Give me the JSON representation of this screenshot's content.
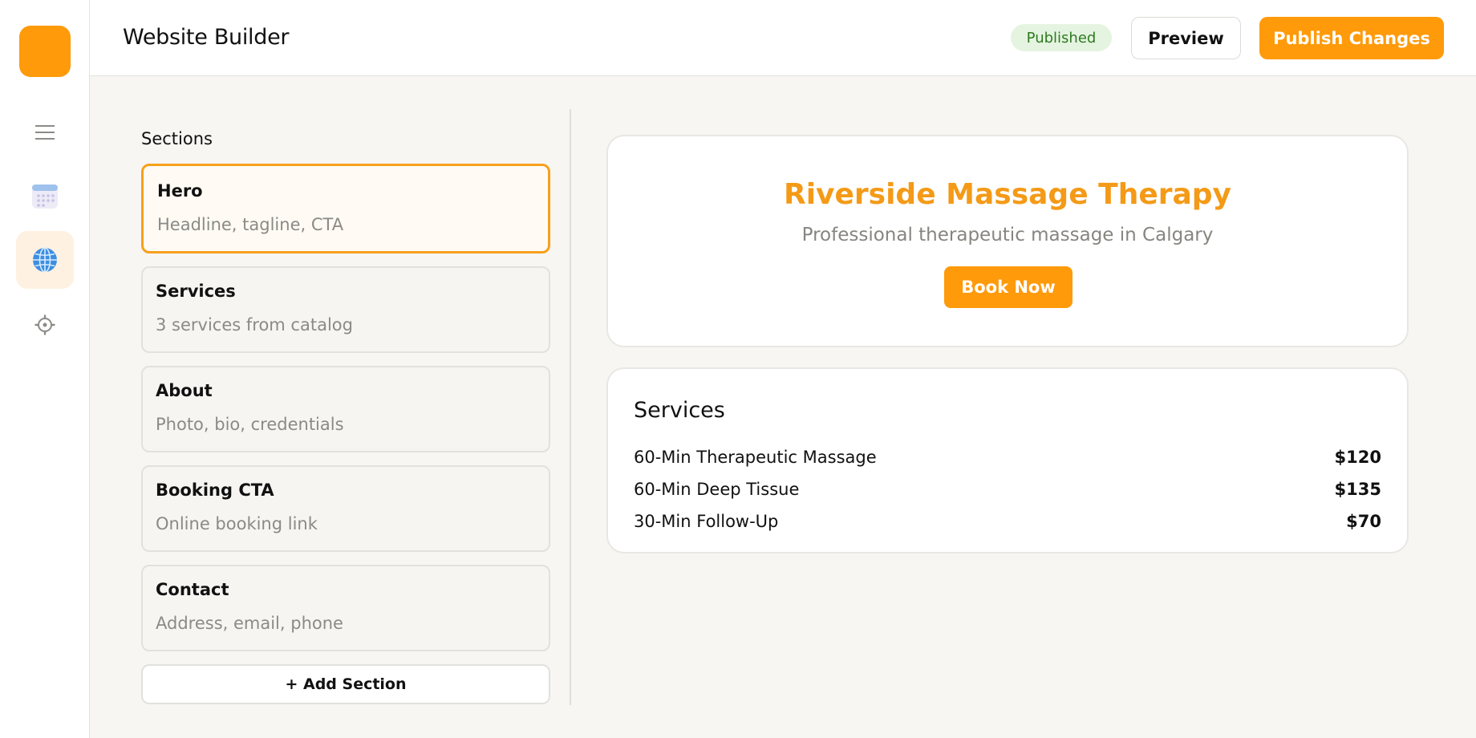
{
  "rail": {
    "items": [
      {
        "icon": "menu-icon"
      },
      {
        "icon": "calendar-icon"
      },
      {
        "icon": "globe-icon",
        "active": true
      },
      {
        "icon": "gear-icon"
      }
    ]
  },
  "header": {
    "title": "Website Builder",
    "status_badge": "Published",
    "preview_label": "Preview",
    "publish_label": "Publish Changes"
  },
  "sections_panel": {
    "title": "Sections",
    "items": [
      {
        "name": "Hero",
        "description": "Headline, tagline, CTA",
        "selected": true
      },
      {
        "name": "Services",
        "description": "3 services from catalog"
      },
      {
        "name": "About",
        "description": "Photo, bio, credentials"
      },
      {
        "name": "Booking CTA",
        "description": "Online booking link"
      },
      {
        "name": "Contact",
        "description": "Address, email, phone"
      }
    ],
    "add_label": "+ Add Section"
  },
  "preview": {
    "hero": {
      "title": "Riverside Massage Therapy",
      "tagline": "Professional therapeutic massage in Calgary",
      "cta_label": "Book Now"
    },
    "services": {
      "title": "Services",
      "items": [
        {
          "name": "60-Min Therapeutic Massage",
          "price": "$120"
        },
        {
          "name": "60-Min Deep Tissue",
          "price": "$135"
        },
        {
          "name": "30-Min Follow-Up",
          "price": "$70"
        }
      ]
    }
  },
  "colors": {
    "accent": "#ff9a0a",
    "accent_text": "#f49a17",
    "selected_border": "#f7a01c",
    "badge_bg": "#e5f4e0",
    "badge_text": "#2f7a22"
  }
}
